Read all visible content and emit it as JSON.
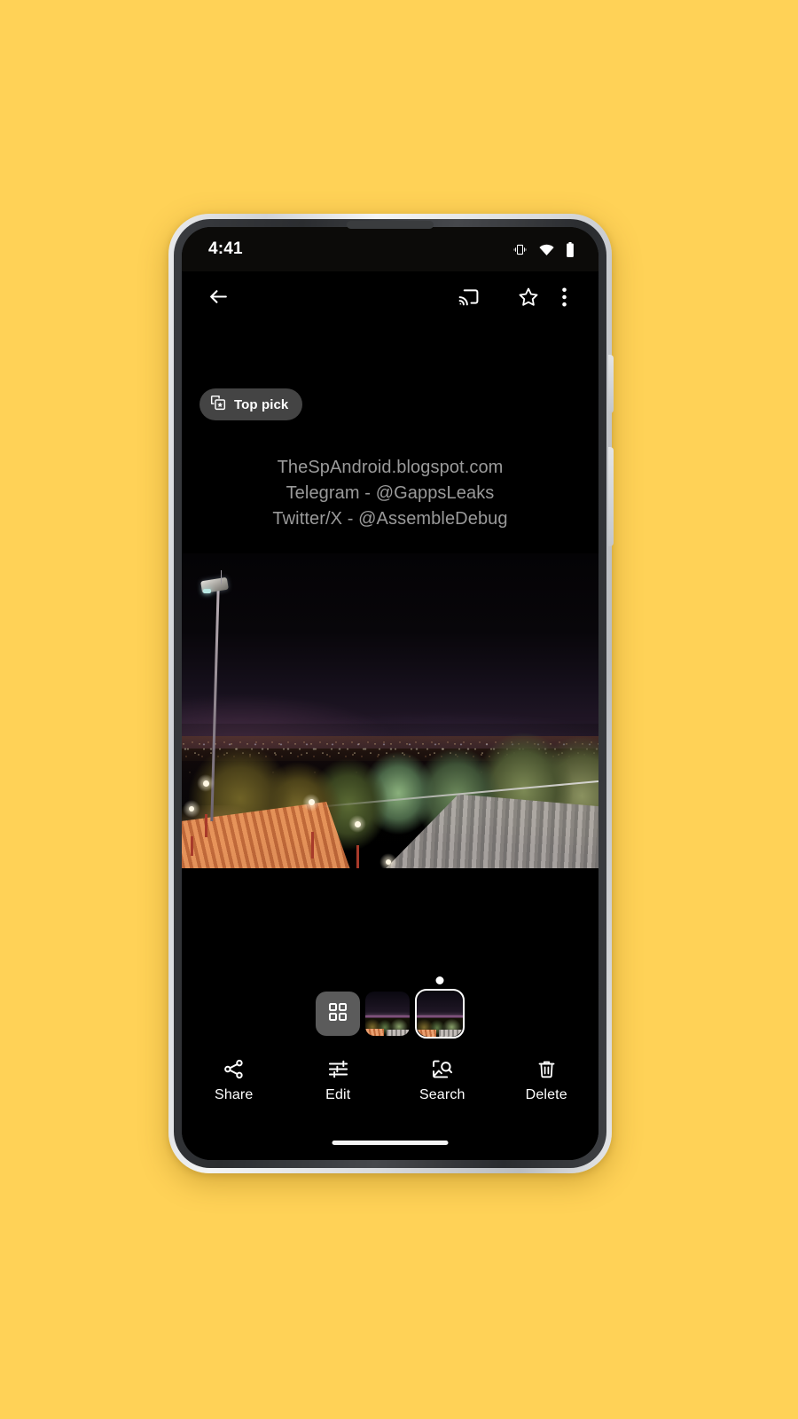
{
  "background": {
    "color": "#FFD257"
  },
  "device": {
    "frame_color": "#d8dadd",
    "bezel_color": "#2b2d30",
    "buttons": [
      {
        "name": "power-button"
      },
      {
        "name": "volume-button"
      }
    ]
  },
  "status_bar": {
    "time": "4:41",
    "icons": [
      {
        "name": "vibrate-icon"
      },
      {
        "name": "wifi-icon"
      },
      {
        "name": "battery-icon"
      }
    ]
  },
  "app_bar": {
    "back": {
      "icon": "back-arrow-icon",
      "label": "Back"
    },
    "cast": {
      "icon": "cast-icon",
      "label": "Cast"
    },
    "favorite": {
      "icon": "star-outline-icon",
      "label": "Favorite"
    },
    "overflow": {
      "icon": "more-vert-icon",
      "label": "More options"
    }
  },
  "chip": {
    "icon": "top-pick-stack-icon",
    "label": "Top pick"
  },
  "photo": {
    "watermark_lines": [
      "TheSpAndroid.blogspot.com",
      "Telegram - @GappsLeaks",
      "Twitter/X - @AssembleDebug"
    ],
    "description": "Night cityscape viewed from a hillside terrace with floodlight pole, trees and metal roof"
  },
  "filmstrip": {
    "grid_button": {
      "icon": "grid-view-icon",
      "label": "Grid view"
    },
    "thumbnails": [
      {
        "name": "thumbnail-1",
        "selected": false
      },
      {
        "name": "thumbnail-2",
        "selected": true
      }
    ]
  },
  "bottom_actions": [
    {
      "icon": "share-icon",
      "label": "Share"
    },
    {
      "icon": "edit-sliders-icon",
      "label": "Edit"
    },
    {
      "icon": "lens-search-icon",
      "label": "Search"
    },
    {
      "icon": "delete-trash-icon",
      "label": "Delete"
    }
  ],
  "nav": {
    "pill": "home-gesture-pill"
  }
}
